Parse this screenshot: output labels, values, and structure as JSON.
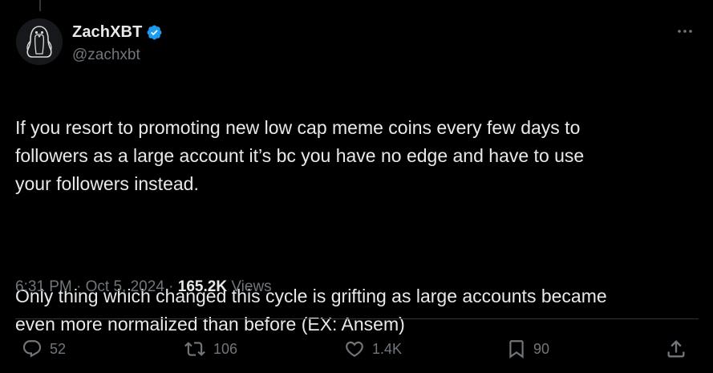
{
  "author": {
    "display_name": "ZachXBT",
    "handle": "@zachxbt",
    "verified": true
  },
  "tweet": {
    "paragraphs": [
      "If you resort to promoting new low cap meme coins every few days to\nfollowers as a large account it’s bc you have no edge and have to use\nyour followers instead.",
      "Only thing which changed this cycle is grifting as large accounts became\neven more normalized than before (EX: Ansem)"
    ]
  },
  "meta": {
    "time": "6:31 PM",
    "separator1": " · ",
    "date": "Oct 5, 2024",
    "separator2": " · ",
    "views_count": "165.2K",
    "views_label": " Views"
  },
  "actions": {
    "replies": "52",
    "reposts": "106",
    "likes": "1.4K",
    "bookmarks": "90"
  },
  "icons": {
    "verified": "verified-badge-icon",
    "more": "more-options-icon",
    "reply": "reply-icon",
    "repost": "repost-icon",
    "like": "heart-icon",
    "bookmark": "bookmark-icon",
    "share": "share-icon"
  },
  "colors": {
    "background": "#000000",
    "text_primary": "#e7e9ea",
    "text_secondary": "#71767b",
    "verified_blue": "#1d9bf0",
    "divider": "#2f3336"
  }
}
